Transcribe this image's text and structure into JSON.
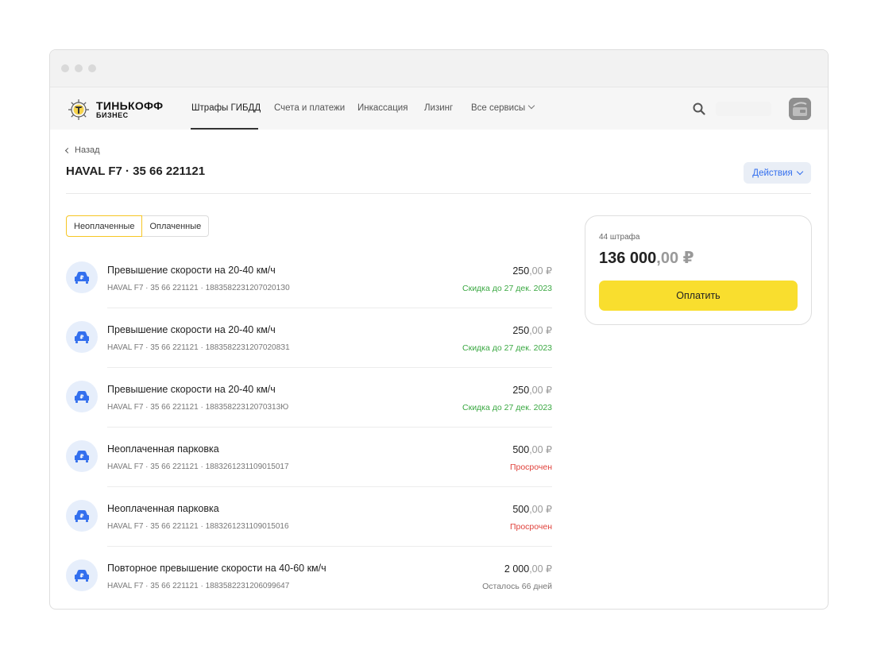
{
  "brand": {
    "name_line1": "ТИНЬКОФФ",
    "name_line2": "БИЗНЕС"
  },
  "nav": {
    "items": [
      {
        "label": "Штрафы ГИБДД",
        "active": true
      },
      {
        "label": "Счета и платежи",
        "active": false
      },
      {
        "label": "Инкассация",
        "active": false
      },
      {
        "label": "Лизинг",
        "active": false
      },
      {
        "label": "Все сервисы",
        "active": false
      }
    ],
    "search_icon": "search-icon",
    "avatar_icon": "wallet-icon"
  },
  "page": {
    "back_label": "Назад",
    "title": "HAVAL F7 · 35 66 221121",
    "actions_label": "Действия"
  },
  "tabs": [
    {
      "label": "Неоплаченные",
      "active": true
    },
    {
      "label": "Оплаченные",
      "active": false
    }
  ],
  "fines": [
    {
      "title": "Превышение скорости на 20-40 км/ч",
      "meta": "HAVAL F7 · 35 66 221121 · 18835822312070201З0",
      "amount_int": "250",
      "amount_dec": ",00 ₽",
      "status": "Скидка до 27 дек. 2023",
      "status_type": "discount"
    },
    {
      "title": "Превышение скорости на 20-40 км/ч",
      "meta": "HAVAL F7 · 35 66 221121 · 18835822312070208З1",
      "amount_int": "250",
      "amount_dec": ",00 ₽",
      "status": "Скидка до 27 дек. 2023",
      "status_type": "discount"
    },
    {
      "title": "Превышение скорости на 20-40 км/ч",
      "meta": "HAVAL F7 · 35 66 221121 · 18835822312070313Ю",
      "amount_int": "250",
      "amount_dec": ",00 ₽",
      "status": "Скидка до 27 дек. 2023",
      "status_type": "discount"
    },
    {
      "title": "Неоплаченная парковка",
      "meta": "HAVAL F7 · 35 66 221121 · 1883261231109015017",
      "amount_int": "500",
      "amount_dec": ",00 ₽",
      "status": "Просрочен",
      "status_type": "overdue"
    },
    {
      "title": "Неоплаченная парковка",
      "meta": "HAVAL F7 · 35 66 221121 · 1883261231109015016",
      "amount_int": "500",
      "amount_dec": ",00 ₽",
      "status": "Просрочен",
      "status_type": "overdue"
    },
    {
      "title": "Повторное превышение скорости на 40-60 км/ч",
      "meta": "HAVAL F7 · 35 66 221121 · 1883582231206099647",
      "amount_int": "2 000",
      "amount_dec": ",00 ₽",
      "status": "Осталось 66 дней",
      "status_type": "neutral"
    }
  ],
  "summary": {
    "count_label": "44 штрафа",
    "total_int": "136 000",
    "total_dec": ",00 ₽",
    "pay_label": "Оплатить"
  },
  "colors": {
    "accent_yellow": "#f9de2e",
    "link_blue": "#336fee",
    "discount_green": "#3aa842",
    "overdue_red": "#e0413b",
    "neutral_gray": "#777777"
  }
}
